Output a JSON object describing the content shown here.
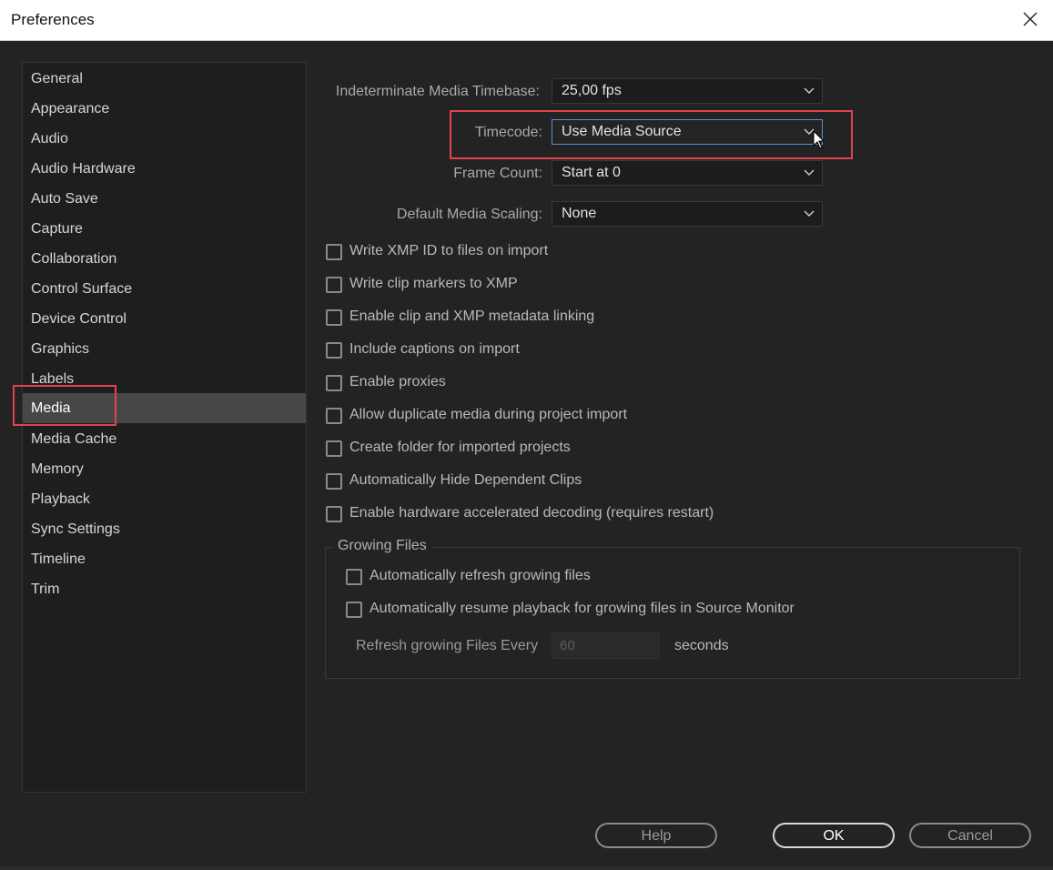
{
  "window": {
    "title": "Preferences"
  },
  "sidebar": {
    "items": [
      {
        "label": "General"
      },
      {
        "label": "Appearance"
      },
      {
        "label": "Audio"
      },
      {
        "label": "Audio Hardware"
      },
      {
        "label": "Auto Save"
      },
      {
        "label": "Capture"
      },
      {
        "label": "Collaboration"
      },
      {
        "label": "Control Surface"
      },
      {
        "label": "Device Control"
      },
      {
        "label": "Graphics"
      },
      {
        "label": "Labels"
      },
      {
        "label": "Media"
      },
      {
        "label": "Media Cache"
      },
      {
        "label": "Memory"
      },
      {
        "label": "Playback"
      },
      {
        "label": "Sync Settings"
      },
      {
        "label": "Timeline"
      },
      {
        "label": "Trim"
      }
    ],
    "selected": "Media"
  },
  "media": {
    "timebase": {
      "label": "Indeterminate Media Timebase:",
      "value": "25,00 fps"
    },
    "timecode": {
      "label": "Timecode:",
      "value": "Use Media Source"
    },
    "frame_count": {
      "label": "Frame Count:",
      "value": "Start at 0"
    },
    "scaling": {
      "label": "Default Media Scaling:",
      "value": "None"
    },
    "checkboxes": [
      {
        "label": "Write XMP ID to files on import",
        "checked": false
      },
      {
        "label": "Write clip markers to XMP",
        "checked": false
      },
      {
        "label": "Enable clip and XMP metadata linking",
        "checked": false
      },
      {
        "label": "Include captions on import",
        "checked": false
      },
      {
        "label": "Enable proxies",
        "checked": false
      },
      {
        "label": "Allow duplicate media during project import",
        "checked": false
      },
      {
        "label": "Create folder for imported projects",
        "checked": false
      },
      {
        "label": "Automatically Hide Dependent Clips",
        "checked": false
      },
      {
        "label": "Enable hardware accelerated decoding (requires restart)",
        "checked": false
      }
    ],
    "growing_files": {
      "title": "Growing Files",
      "checkboxes": [
        {
          "label": "Automatically refresh growing files",
          "checked": false
        },
        {
          "label": "Automatically resume playback for growing files in Source Monitor",
          "checked": false
        }
      ],
      "refresh_label": "Refresh growing Files Every",
      "refresh_value": "60",
      "seconds_label": "seconds"
    }
  },
  "buttons": {
    "help": "Help",
    "ok": "OK",
    "cancel": "Cancel"
  },
  "colors": {
    "highlight": "#e0444c",
    "focus": "#5d8fd6",
    "selected_bg": "#474747"
  }
}
